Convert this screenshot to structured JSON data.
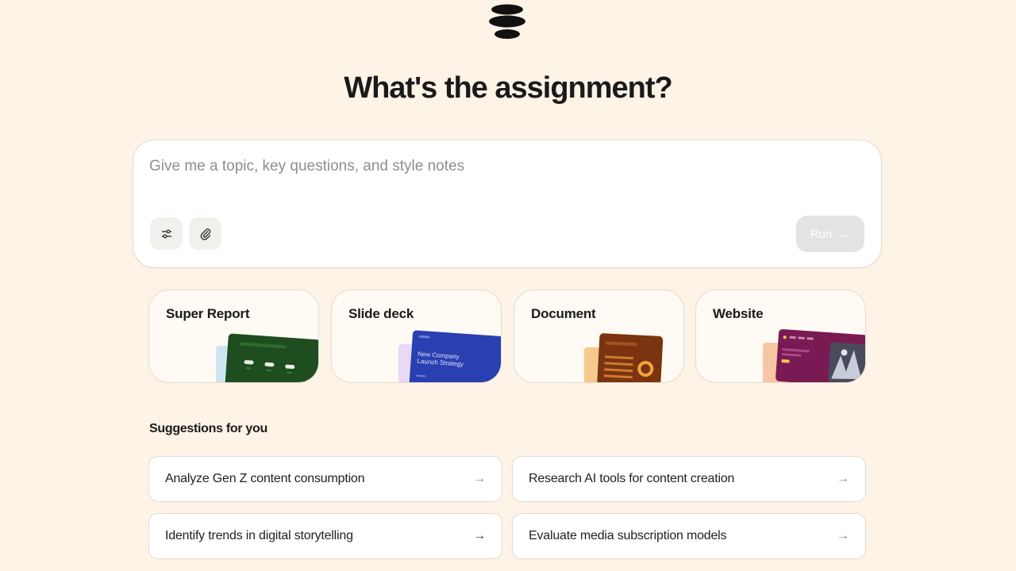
{
  "headline": "What's the assignment?",
  "prompt": {
    "placeholder": "Give me a topic, key questions, and style notes",
    "value": "",
    "run_label": "Run"
  },
  "output_types": [
    {
      "label": "Super Report",
      "preview_text": ""
    },
    {
      "label": "Slide deck",
      "preview_text": "New Company Launch Strategy"
    },
    {
      "label": "Document",
      "preview_text": ""
    },
    {
      "label": "Website",
      "preview_text": ""
    }
  ],
  "suggestions_title": "Suggestions for you",
  "suggestions": [
    {
      "label": "Analyze Gen Z content consumption"
    },
    {
      "label": "Research AI tools for content creation"
    },
    {
      "label": "Identify trends in digital storytelling"
    },
    {
      "label": "Evaluate media subscription models"
    }
  ],
  "colors": {
    "background": "#fdf3e6",
    "report_green": "#1e4d1f",
    "deck_blue": "#2a3fb0",
    "document_brown": "#7a3410",
    "website_purple": "#7a1a55"
  },
  "icons": [
    "logo-icon",
    "sliders-icon",
    "paperclip-icon",
    "arrow-right-icon"
  ]
}
